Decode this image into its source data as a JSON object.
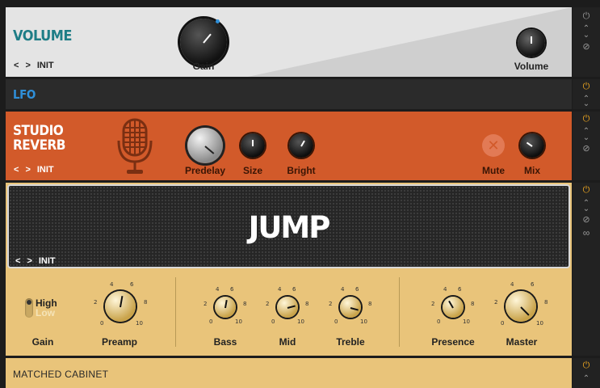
{
  "volume_panel": {
    "title": "VOLUME",
    "preset_prev": "<",
    "preset_next": ">",
    "preset": "INIT",
    "gain_label": "Gain",
    "volume_label": "Volume"
  },
  "lfo_panel": {
    "title": "LFO"
  },
  "reverb_panel": {
    "title_line1": "STUDIO",
    "title_line2": "REVERB",
    "preset_prev": "<",
    "preset_next": ">",
    "preset": "INIT",
    "knobs": [
      "Predelay",
      "Size",
      "Bright"
    ],
    "mute_label": "Mute",
    "mute_symbol": "✕",
    "mix_label": "Mix"
  },
  "amp_panel": {
    "logo": "JUMP",
    "preset_prev": "<",
    "preset_next": ">",
    "preset": "INIT",
    "gain_switch": {
      "high": "High",
      "low": "Low",
      "label": "Gain"
    },
    "knob_labels": [
      "Preamp",
      "Bass",
      "Mid",
      "Treble",
      "Presence",
      "Master"
    ],
    "scale": [
      "0",
      "2",
      "4",
      "6",
      "8",
      "10"
    ]
  },
  "cabinet_panel": {
    "title": "MATCHED CABINET"
  },
  "side_icons": {
    "power": "⏻",
    "collapse": "⌃",
    "expand": "⌄",
    "disable": "⊘",
    "link": "∞"
  },
  "colors": {
    "volume_bg": "#e3e3e3",
    "volume_title": "#1e7d86",
    "lfo_bg": "#2a2a2a",
    "lfo_title": "#2f8fd8",
    "reverb_bg": "#d25a2a",
    "amp_grille": "#262626",
    "amp_gold": "#e9c47a",
    "power_on": "#f0a820"
  }
}
